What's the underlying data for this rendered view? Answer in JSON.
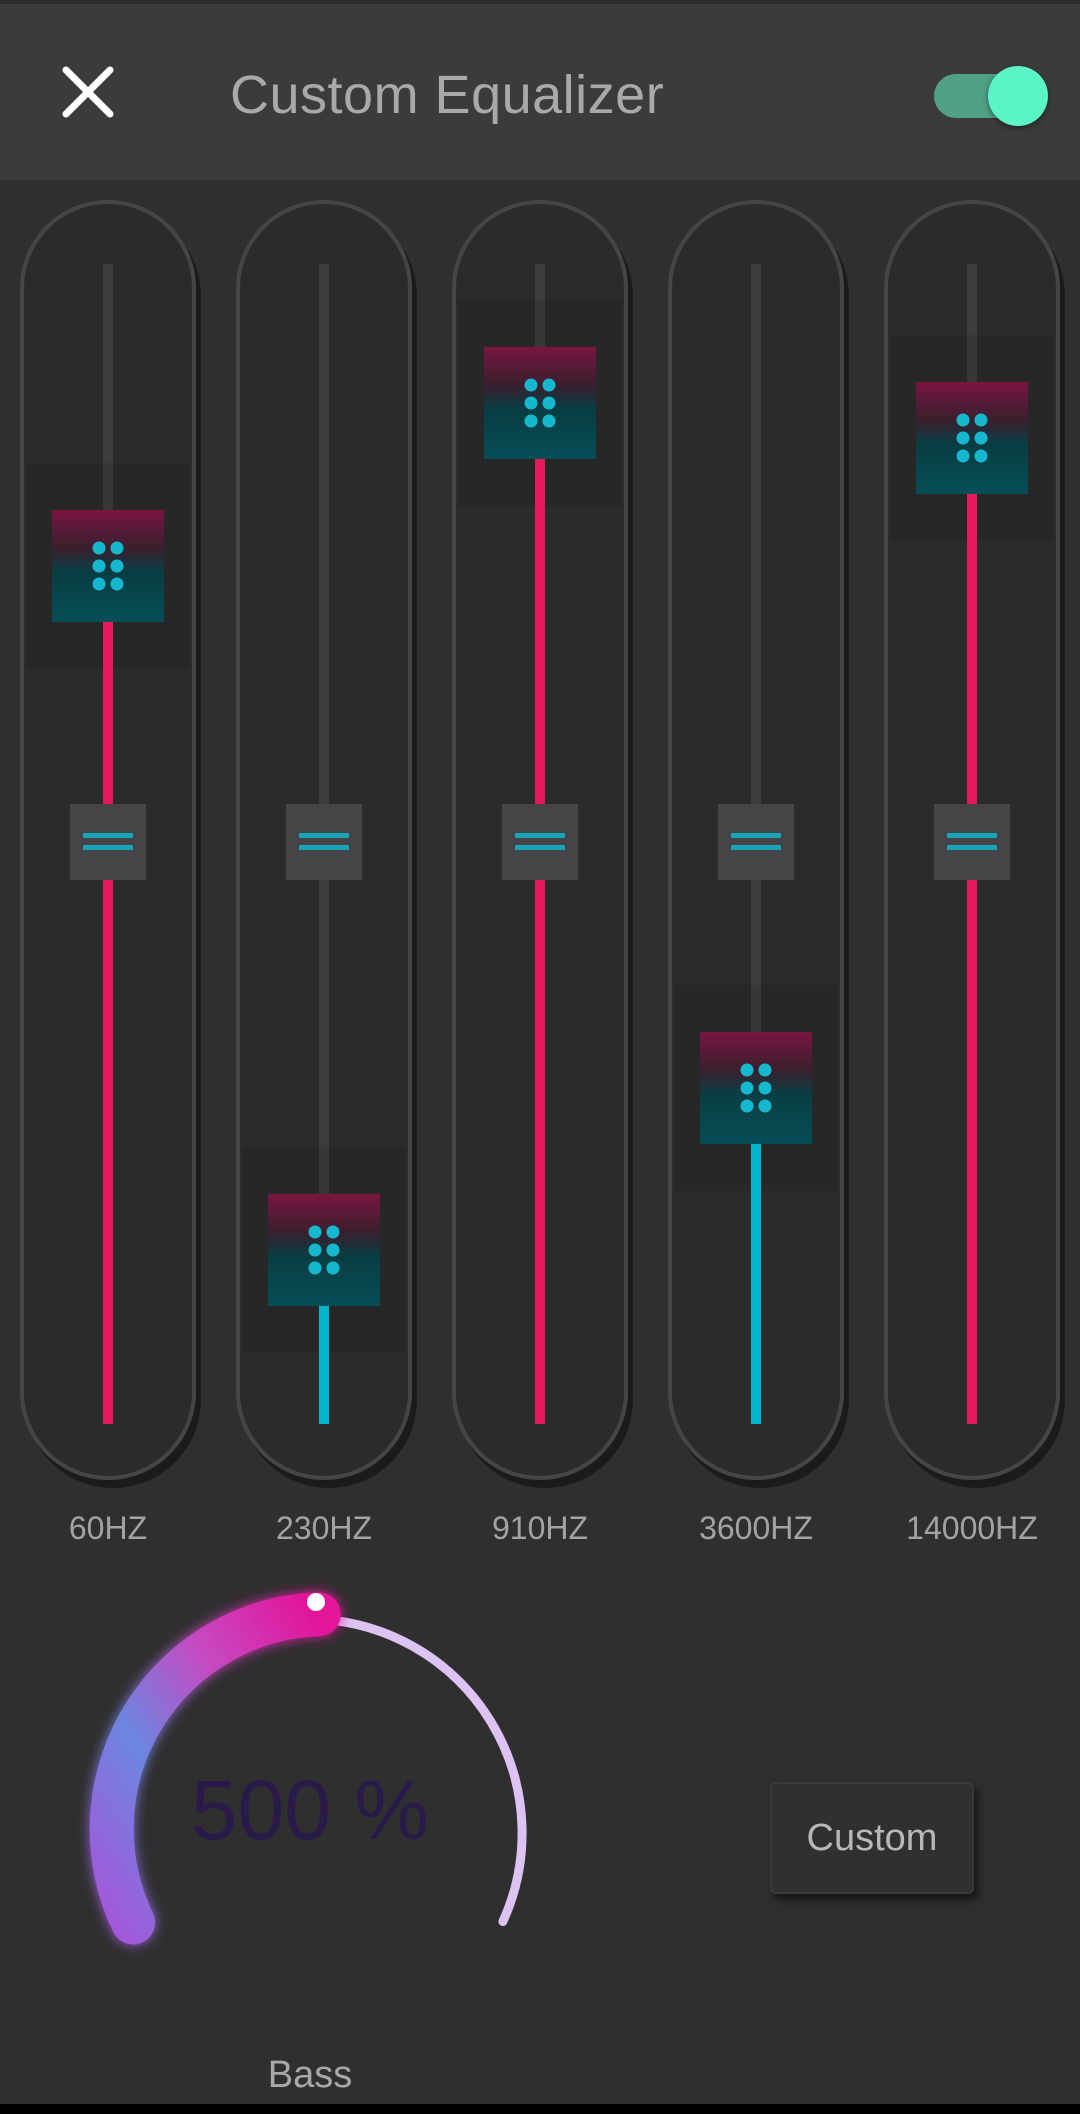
{
  "header": {
    "title": "Custom Equalizer",
    "close_icon": "close-icon",
    "enabled": true,
    "toggle_color": "#5cf5c8"
  },
  "bands": [
    {
      "label": "60HZ",
      "level": 0.74
    },
    {
      "label": "230HZ",
      "level": 0.15
    },
    {
      "label": "910HZ",
      "level": 0.88
    },
    {
      "label": "3600HZ",
      "level": 0.29
    },
    {
      "label": "14000HZ",
      "level": 0.85
    }
  ],
  "colors": {
    "boost": "#e41a5d",
    "cut": "#00b6cf",
    "handle_dots": "#16b8cf",
    "background": "#2f2f30"
  },
  "bass": {
    "value_text": "500 %",
    "label": "Bass",
    "level": 0.42
  },
  "preset": {
    "button_label": "Custom"
  }
}
